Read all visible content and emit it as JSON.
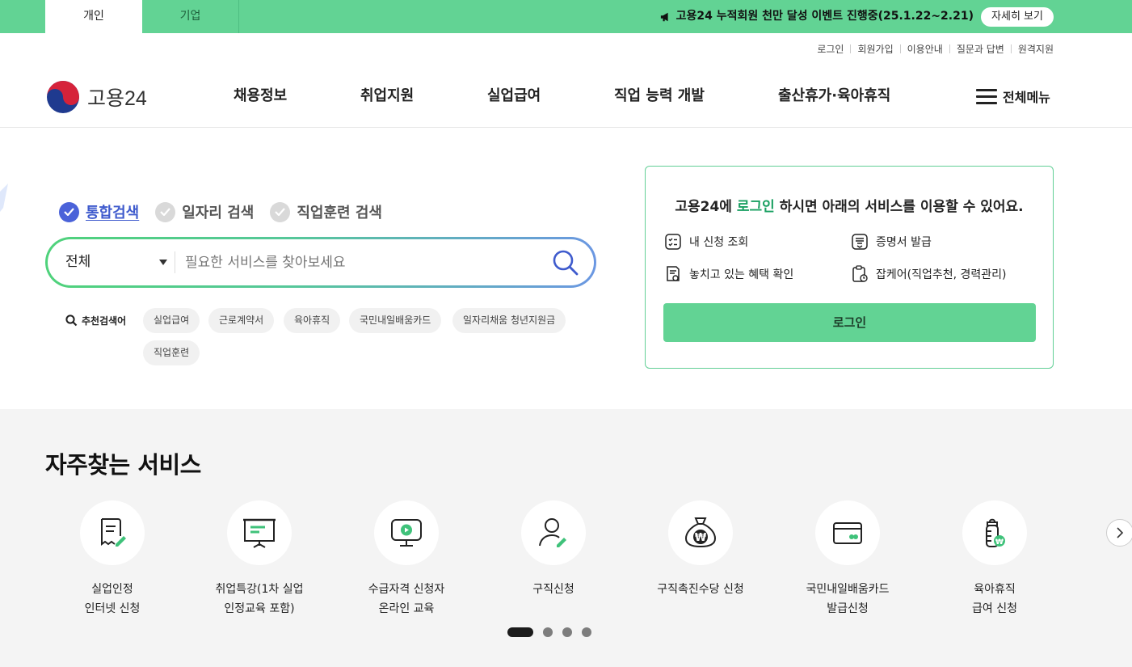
{
  "topbar": {
    "tabs": [
      {
        "label": "개인"
      },
      {
        "label": "기업"
      }
    ],
    "notice": "고용24 누적회원 천만 달성 이벤트 진행중(25.1.22~2.21)",
    "more_label": "자세히 보기"
  },
  "util_links": [
    "로그인",
    "회원가입",
    "이용안내",
    "질문과 답변",
    "원격지원"
  ],
  "header": {
    "logo_text": "고용24",
    "nav": [
      "채용정보",
      "취업지원",
      "실업급여",
      "직업 능력 개발",
      "출산휴가·육아휴직"
    ],
    "all_menu": "전체메뉴"
  },
  "search": {
    "tabs": [
      "통합검색",
      "일자리 검색",
      "직업훈련 검색"
    ],
    "active_tab": 0,
    "category": "전체",
    "placeholder": "필요한 서비스를 찾아보세요",
    "recommend_label": "추천검색어",
    "keywords": [
      "실업급여",
      "근로계약서",
      "육아휴직",
      "국민내일배움카드",
      "일자리채움 청년지원금",
      "직업훈련"
    ]
  },
  "login_box": {
    "title_pre": "고용24에 ",
    "title_highlight": "로그인",
    "title_post": " 하시면 아래의 서비스를 이용할 수 있어요.",
    "services": [
      "내 신청 조회",
      "증명서 발급",
      "놓치고 있는 혜택 확인",
      "잡케어(직업추천, 경력관리)"
    ],
    "button": "로그인"
  },
  "frequent": {
    "title": "자주찾는 서비스",
    "items": [
      {
        "line1": "실업인정",
        "line2": "인터넷 신청",
        "icon": "document-pen-icon"
      },
      {
        "line1": "취업특강(1차 실업",
        "line2": "인정교육 포함)",
        "icon": "presentation-board-icon"
      },
      {
        "line1": "수급자격 신청자",
        "line2": "온라인 교육",
        "icon": "monitor-play-icon"
      },
      {
        "line1": "구직신청",
        "line2": "",
        "icon": "person-pen-icon"
      },
      {
        "line1": "구직촉진수당 신청",
        "line2": "",
        "icon": "money-bag-icon"
      },
      {
        "line1": "국민내일배움카드",
        "line2": "발급신청",
        "icon": "card-icon"
      },
      {
        "line1": "육아휴직",
        "line2": "급여 신청",
        "icon": "baby-bottle-icon"
      }
    ],
    "pages": 4,
    "current_page": 1
  },
  "colors": {
    "brand_green": "#62d394",
    "search_blue": "#4a62d9",
    "highlight_green": "#1aa062"
  }
}
